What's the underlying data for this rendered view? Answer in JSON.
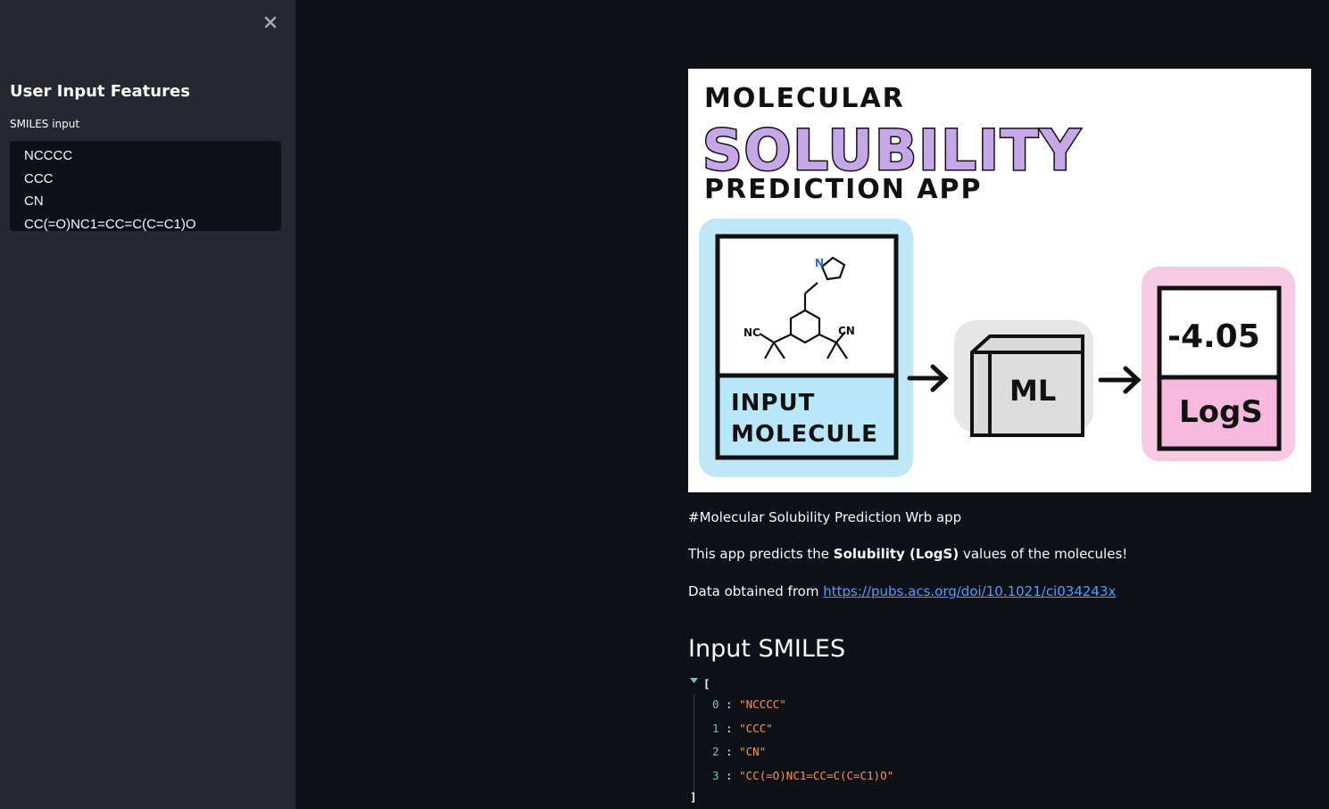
{
  "sidebar": {
    "title": "User Input Features",
    "input_label": "SMILES input",
    "smiles_lines": [
      "NCCCC",
      "CCC",
      "CN",
      "CC(=O)NC1=CC=C(C=C1)O"
    ]
  },
  "hero": {
    "title_top": "MOLECULAR",
    "title_mid": "SOLUBILITY",
    "title_bottom": "PREDICTION APP",
    "input_label_1": "INPUT",
    "input_label_2": "MOLECULE",
    "ml_label": "ML",
    "output_value": "-4.05",
    "output_label": "LogS",
    "atom_n": "N",
    "atom_nc": "NC",
    "atom_cn": "CN"
  },
  "main": {
    "heading_line": "#Molecular Solubility Prediction Wrb app",
    "desc_prefix": "This app predicts the ",
    "desc_bold": "Solubility (LogS)",
    "desc_suffix": " values of the molecules!",
    "source_prefix": "Data obtained from ",
    "source_link": "https://pubs.acs.org/doi/10.1021/ci034243x",
    "section_title": "Input SMILES"
  },
  "json_view": {
    "open_bracket": "[",
    "close_bracket": "]",
    "items": [
      {
        "index": "0",
        "value": "\"NCCCC\""
      },
      {
        "index": "1",
        "value": "\"CCC\""
      },
      {
        "index": "2",
        "value": "\"CN\""
      },
      {
        "index": "3",
        "value": "\"CC(=O)NC1=CC=C(C=C1)O\""
      }
    ],
    "colon": ":"
  },
  "colors": {
    "background": "#0e1117",
    "sidebar": "#262730",
    "link": "#4b9fff",
    "json_index": "#72c2ac",
    "json_string": "#ff9147"
  },
  "icons": [
    "close-icon",
    "collapse-triangle-icon"
  ]
}
